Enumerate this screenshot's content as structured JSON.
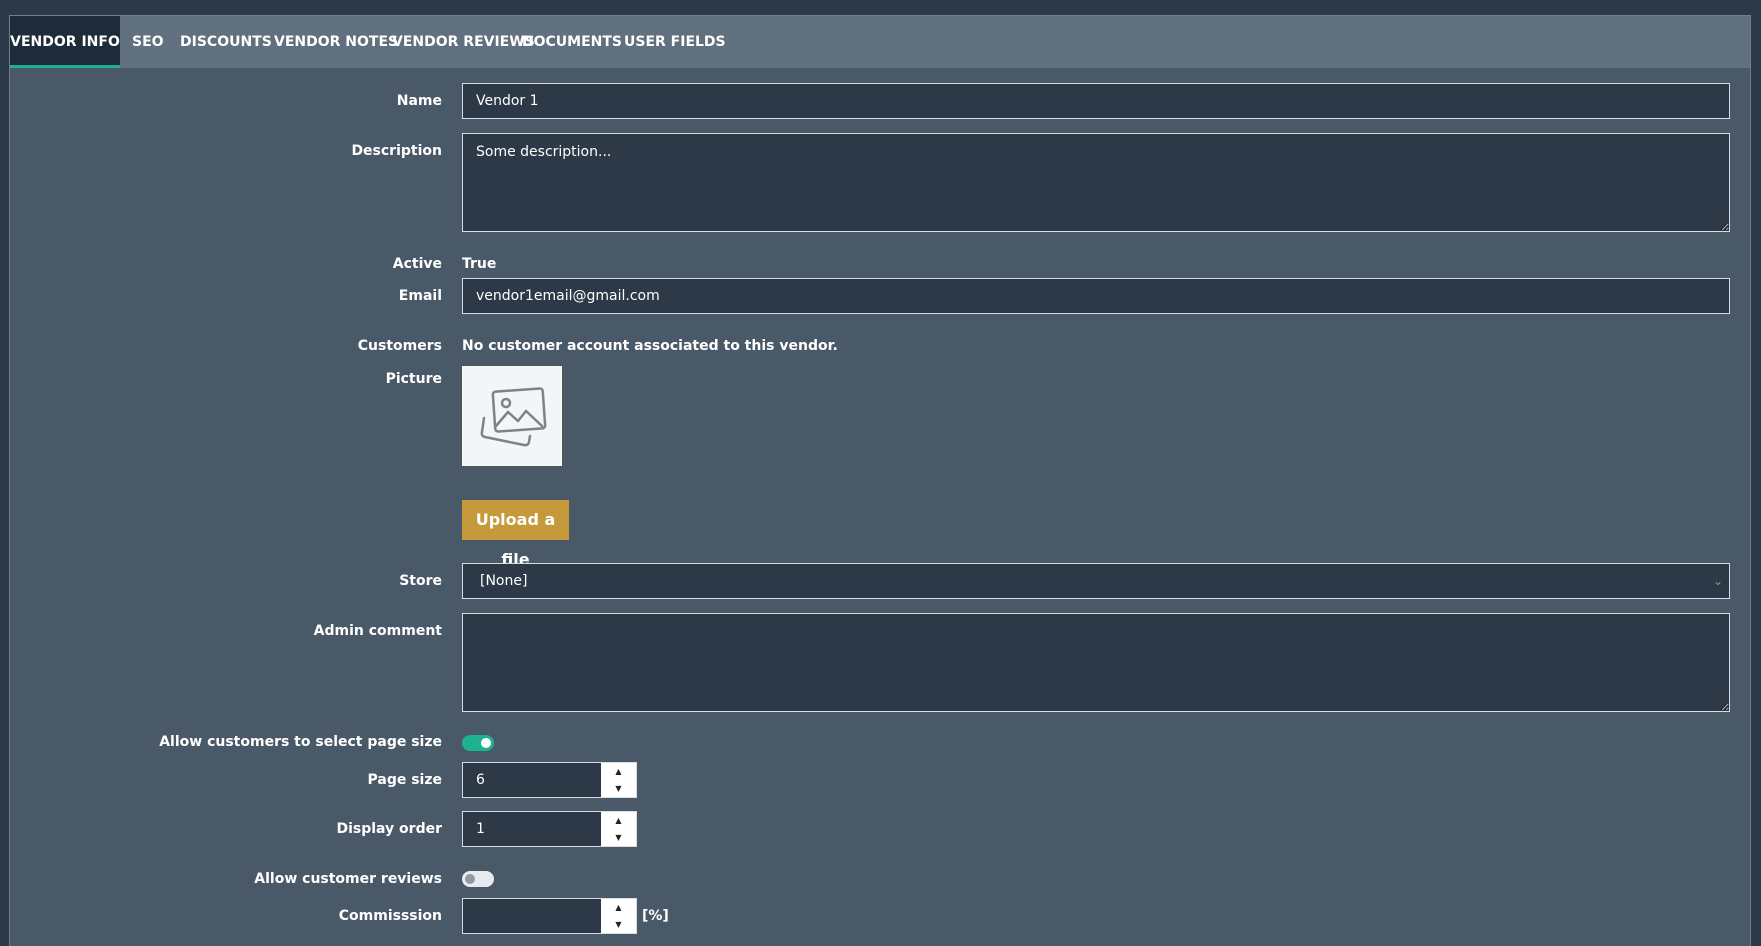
{
  "tabs": [
    {
      "label": "VENDOR INFO",
      "active": true
    },
    {
      "label": "SEO"
    },
    {
      "label": "DISCOUNTS"
    },
    {
      "label": "VENDOR NOTES"
    },
    {
      "label": "VENDOR REVIEWS"
    },
    {
      "label": "DOCUMENTS"
    },
    {
      "label": "USER FIELDS"
    }
  ],
  "form": {
    "name": {
      "label": "Name",
      "value": "Vendor 1"
    },
    "description": {
      "label": "Description",
      "value": "Some description..."
    },
    "active": {
      "label": "Active",
      "value": "True"
    },
    "email": {
      "label": "Email",
      "value": "vendor1email@gmail.com"
    },
    "customers": {
      "label": "Customers",
      "value": "No customer account associated to this vendor."
    },
    "picture": {
      "label": "Picture",
      "icon": "image-placeholder-icon",
      "upload_label": "Upload a file"
    },
    "store": {
      "label": "Store",
      "value": "[None]"
    },
    "admin_comment": {
      "label": "Admin comment",
      "value": ""
    },
    "allow_page_size": {
      "label": "Allow customers to select page size",
      "on": true
    },
    "page_size": {
      "label": "Page size",
      "value": "6"
    },
    "display_order": {
      "label": "Display order",
      "value": "1"
    },
    "allow_reviews": {
      "label": "Allow customer reviews",
      "on": false
    },
    "commission": {
      "label": "Commisssion",
      "value": "",
      "suffix": "[%]"
    }
  },
  "colors": {
    "accent": "#1fb28e",
    "upload_button": "#c49a3a",
    "panel": "#4a5968",
    "tabbar": "#61707f"
  }
}
